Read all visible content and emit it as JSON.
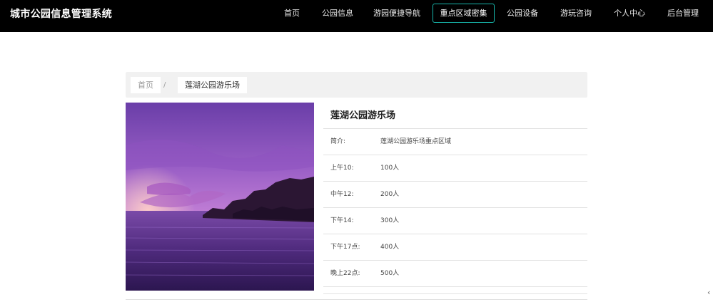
{
  "header": {
    "site_title": "城市公园信息管理系统",
    "nav": [
      {
        "label": "首页",
        "active": false
      },
      {
        "label": "公园信息",
        "active": false
      },
      {
        "label": "游园便捷导航",
        "active": false
      },
      {
        "label": "重点区域密集",
        "active": true
      },
      {
        "label": "公园设备",
        "active": false
      },
      {
        "label": "游玩咨询",
        "active": false
      },
      {
        "label": "个人中心",
        "active": false
      },
      {
        "label": "后台管理",
        "active": false
      }
    ],
    "active_color": "#17b3a8"
  },
  "breadcrumb": {
    "home": "首页",
    "separator": "/",
    "current": "莲湖公园游乐场"
  },
  "detail": {
    "title": "莲湖公园游乐场",
    "rows": [
      {
        "label": "简介:",
        "value": "莲湖公园游乐场重点区域"
      },
      {
        "label": "上午10:",
        "value": "100人"
      },
      {
        "label": "中午12:",
        "value": "200人"
      },
      {
        "label": "下午14:",
        "value": "300人"
      },
      {
        "label": "下午17点:",
        "value": "400人"
      },
      {
        "label": "晚上22点:",
        "value": "500人"
      }
    ]
  }
}
